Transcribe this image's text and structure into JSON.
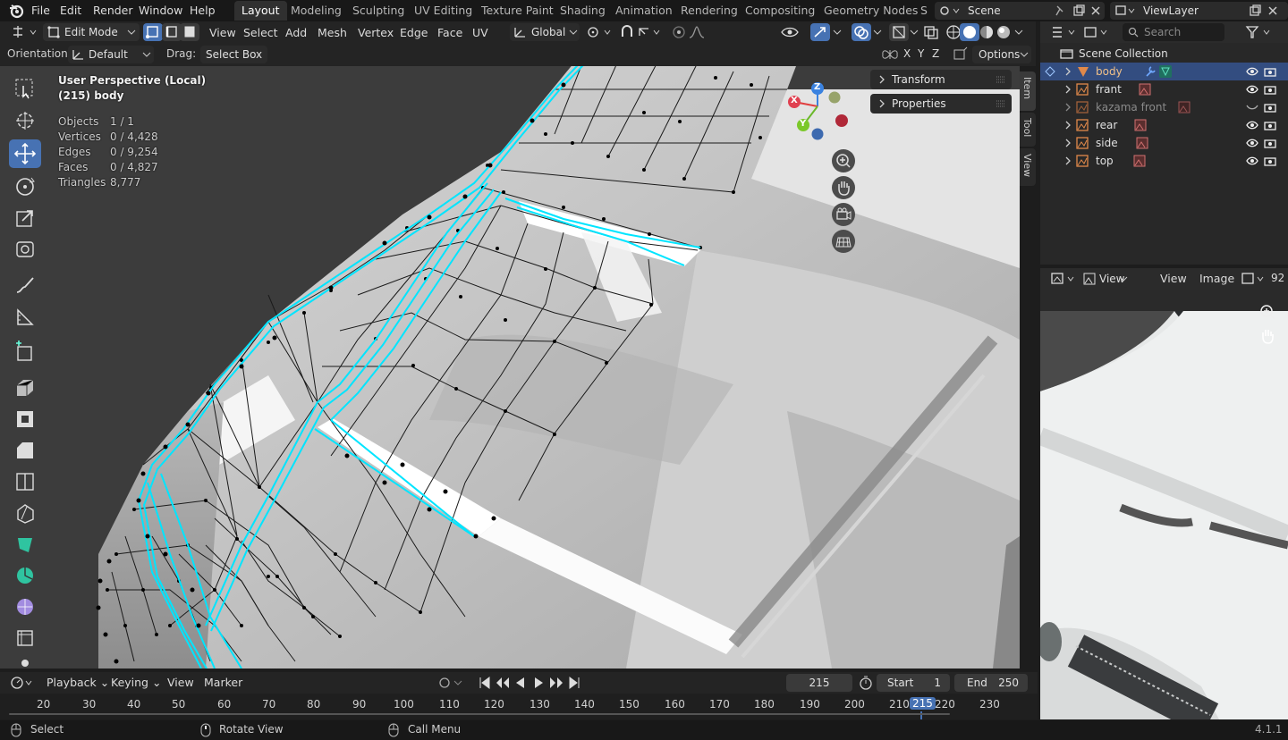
{
  "menubar": {
    "items": [
      "File",
      "Edit",
      "Render",
      "Window",
      "Help"
    ],
    "workspaces": [
      "Layout",
      "Modeling",
      "Sculpting",
      "UV Editing",
      "Texture Paint",
      "Shading",
      "Animation",
      "Rendering",
      "Compositing",
      "Geometry Nodes",
      "S"
    ],
    "active_workspace": "Layout",
    "scene": "Scene",
    "view_layer": "ViewLayer"
  },
  "viewport_header": {
    "mode": "Edit Mode",
    "menus": [
      "View",
      "Select",
      "Add",
      "Mesh",
      "Vertex",
      "Edge",
      "Face",
      "UV"
    ],
    "transform_orientation": "Global",
    "orientation_label": "Orientation:",
    "orientation_value": "Default",
    "drag_label": "Drag:",
    "drag_value": "Select Box",
    "options_label": "Options",
    "axes": [
      "X",
      "Y",
      "Z"
    ]
  },
  "viewport_overlay": {
    "title": "User Perspective (Local)",
    "object": "(215) body",
    "stats": [
      {
        "label": "Objects",
        "value": "1 / 1"
      },
      {
        "label": "Vertices",
        "value": "0 / 4,428"
      },
      {
        "label": "Edges",
        "value": "0 / 9,254"
      },
      {
        "label": "Faces",
        "value": "0 / 4,827"
      },
      {
        "label": "Triangles",
        "value": "8,777"
      }
    ]
  },
  "sidebar": {
    "panels": [
      "Transform",
      "Properties"
    ],
    "tabs": [
      "Item",
      "Tool",
      "View"
    ]
  },
  "gizmo": {
    "x": "X",
    "y": "Y",
    "z": "Z"
  },
  "outliner": {
    "search_placeholder": "Search",
    "collection": "Scene Collection",
    "items": [
      {
        "name": "body",
        "selected": true
      },
      {
        "name": "frant",
        "selected": false
      },
      {
        "name": "kazama front",
        "selected": false
      },
      {
        "name": "rear",
        "selected": false
      },
      {
        "name": "side",
        "selected": false
      },
      {
        "name": "top",
        "selected": false
      }
    ]
  },
  "image_editor": {
    "view_dd": "View",
    "menus": [
      "View",
      "Image"
    ],
    "partial": "92"
  },
  "timeline": {
    "menus": [
      "Playback",
      "Keying",
      "View",
      "Marker"
    ],
    "current_frame": "215",
    "start_label": "Start",
    "start": "1",
    "end_label": "End",
    "end": "250",
    "ticks": [
      "20",
      "30",
      "40",
      "50",
      "60",
      "70",
      "80",
      "90",
      "100",
      "110",
      "120",
      "130",
      "140",
      "150",
      "160",
      "170",
      "180",
      "190",
      "200",
      "210",
      "215",
      "220",
      "230"
    ]
  },
  "statusbar": {
    "select": "Select",
    "rotate": "Rotate View",
    "menu": "Call Menu",
    "version": "4.1.1"
  },
  "colors": {
    "accent": "#4772b3",
    "edge_highlight": "#00e5ff",
    "active_outliner": "#334d80"
  }
}
